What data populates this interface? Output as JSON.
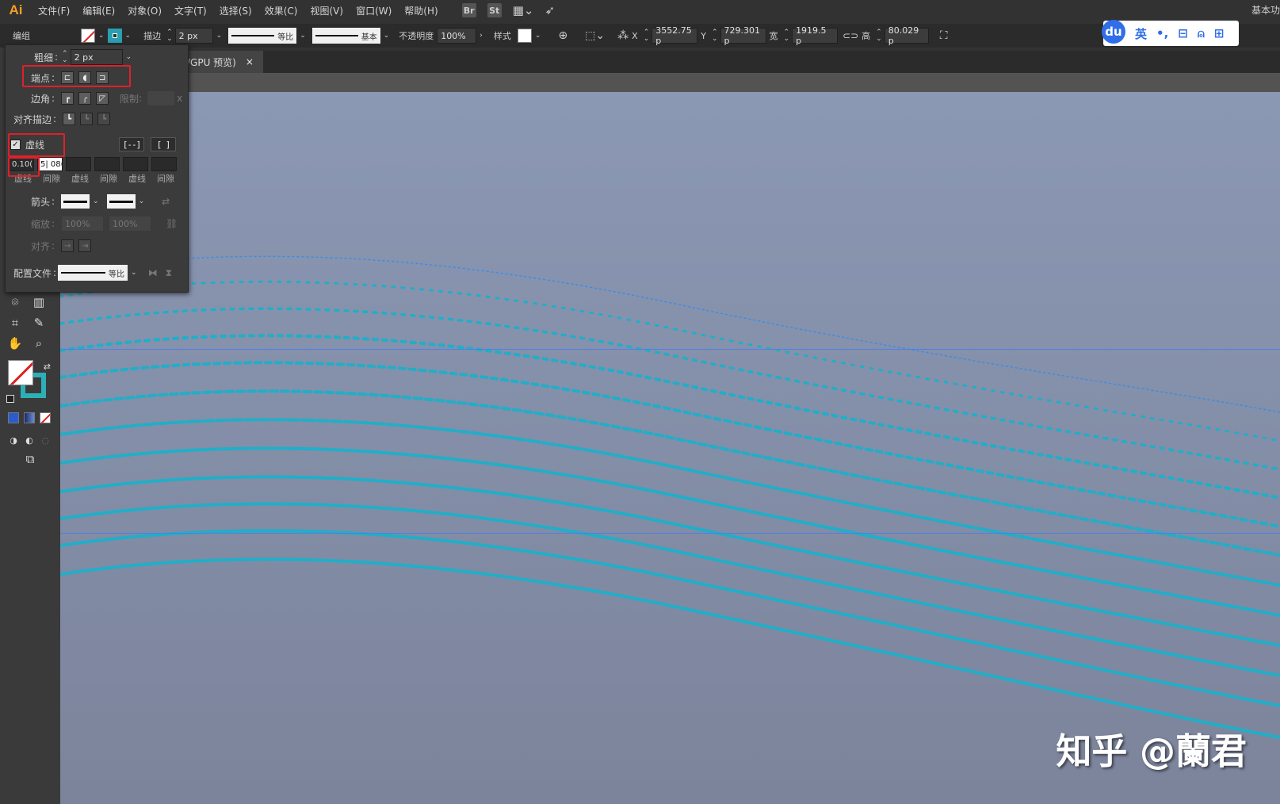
{
  "app": {
    "logo": "Ai",
    "workspace": "基本功"
  },
  "menu": [
    "文件(F)",
    "编辑(E)",
    "对象(O)",
    "文字(T)",
    "选择(S)",
    "效果(C)",
    "视图(V)",
    "窗口(W)",
    "帮助(H)"
  ],
  "menu_icons": {
    "bridge": "Br",
    "stock": "St"
  },
  "control": {
    "selection_label": "编组",
    "stroke_label": "描边",
    "stroke_value": "2 px",
    "profile_label": "等比",
    "brush_label": "基本",
    "opacity_label": "不透明度",
    "opacity_value": "100%",
    "style_label": "样式",
    "x_label": "X",
    "x_value": "3552.75 p",
    "y_label": "Y",
    "y_value": "729.301 p",
    "w_label": "宽",
    "w_value": "1919.5 p",
    "h_label": "高",
    "h_value": "80.029 p"
  },
  "baidu": {
    "logo": "du",
    "lang": "英",
    "punct": "•,",
    "toolbox": "⊟",
    "user": "⍝",
    "grid": "⊞"
  },
  "document": {
    "tab_label": "/GPU 预览)",
    "close": "×"
  },
  "stroke_panel": {
    "weight_label": "粗细",
    "weight_value": "2 px",
    "cap_label": "端点",
    "corner_label": "边角",
    "limit_label": "限制",
    "limit_suffix": "x",
    "align_label": "对齐描边",
    "dashed_label": "虚线",
    "dashed_checked": true,
    "dash_values": [
      "0.10(",
      "5| 08(",
      "",
      "",
      "",
      ""
    ],
    "dash_labels": [
      "虚线",
      "间隙",
      "虚线",
      "间隙",
      "虚线",
      "间隙"
    ],
    "arrow_label": "箭头",
    "scale_label": "缩放",
    "scale_values": [
      "100%",
      "100%"
    ],
    "align_arrow_label": "对齐",
    "profile_label": "配置文件",
    "profile_value": "等比"
  },
  "canvas": {
    "background_top": "#8b98b4",
    "background_bottom": "#7c849b",
    "wave_color": "#21aec8",
    "guide_color": "#4a7fe8"
  },
  "watermark": "知乎 @蘭君"
}
